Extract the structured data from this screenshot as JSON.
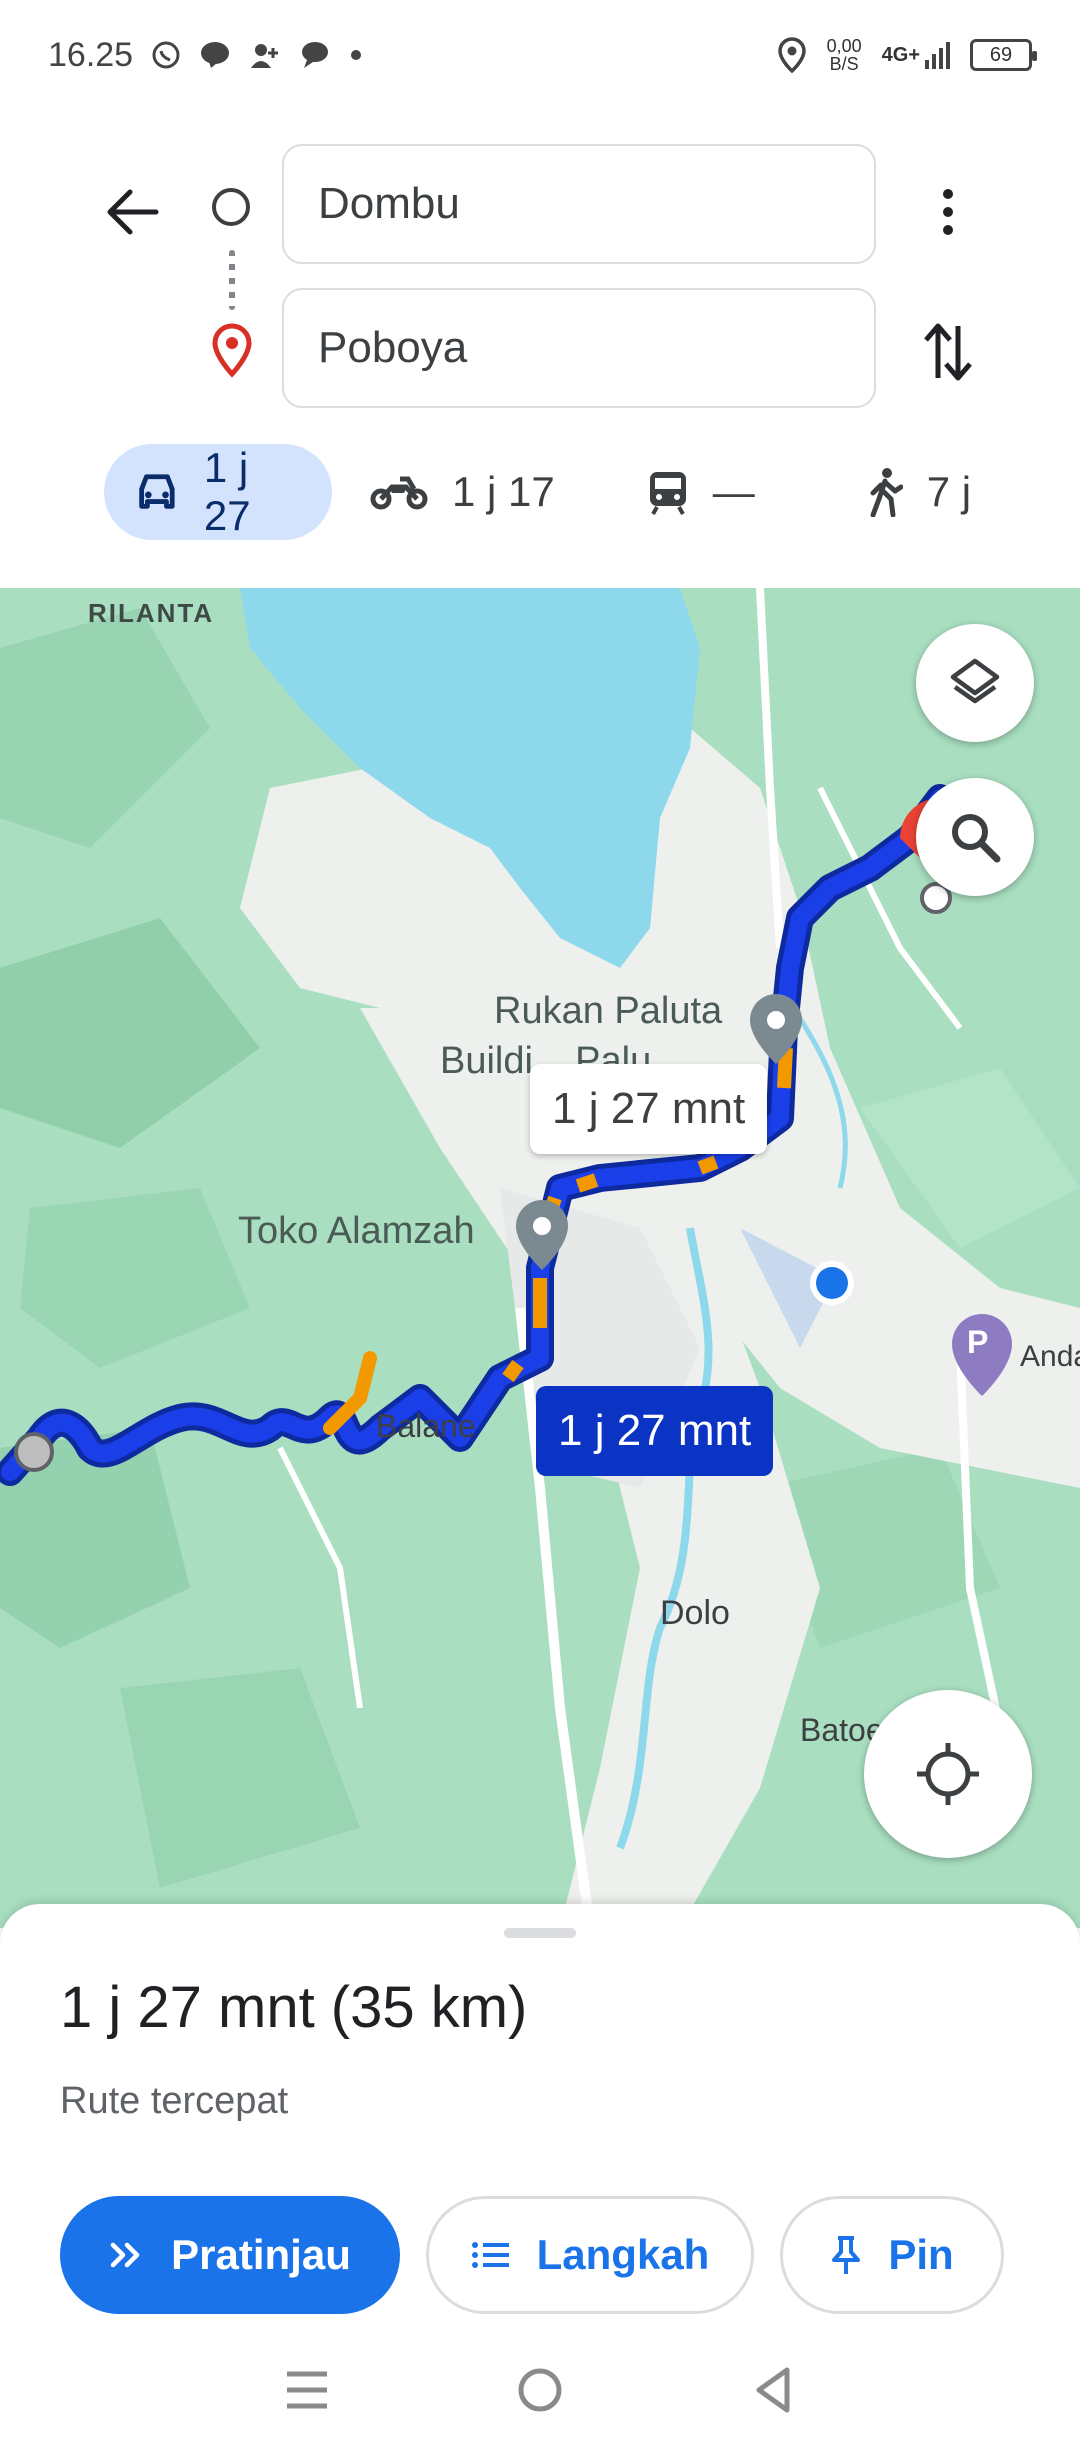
{
  "status_bar": {
    "time": "16.25",
    "net_speed_value": "0,00",
    "net_speed_unit": "B/S",
    "network": "4G+",
    "battery": "69",
    "icons": [
      "whatsapp-icon",
      "line-icon",
      "add-contact-icon",
      "chat-icon",
      "dot-icon",
      "location-icon",
      "signal-icon",
      "battery-icon"
    ]
  },
  "directions": {
    "origin": "Dombu",
    "destination": "Poboya"
  },
  "travel_modes": [
    {
      "mode": "car",
      "label": "1 j 27",
      "active": true
    },
    {
      "mode": "motorcycle",
      "label": "1 j 17",
      "active": false
    },
    {
      "mode": "transit",
      "label": "—",
      "active": false
    },
    {
      "mode": "walk",
      "label": "7 j",
      "active": false
    }
  ],
  "map": {
    "labels": {
      "rilanta": "RILANTA",
      "rukan_line1": "Rukan Paluta",
      "rukan_line2": "Buildi... Palu",
      "toko": "Toko Alamzah",
      "balane": "Balane",
      "dolo": "Dolo",
      "batoe": "Batoenondje",
      "anda": "Anda",
      "parking": "P"
    },
    "eta_alt": "1 j 27 mnt",
    "eta_main": "1 j 27 mnt",
    "colors": {
      "route": "#1a3ee8",
      "traffic": "#f29900",
      "water": "#8ed8ec",
      "land": "#a9dfc0",
      "urban": "#eef0ee"
    }
  },
  "sheet": {
    "summary": "1 j 27 mnt (35 km)",
    "description": "Rute tercepat",
    "buttons": {
      "preview": "Pratinjau",
      "steps": "Langkah",
      "pin": "Pin"
    }
  }
}
